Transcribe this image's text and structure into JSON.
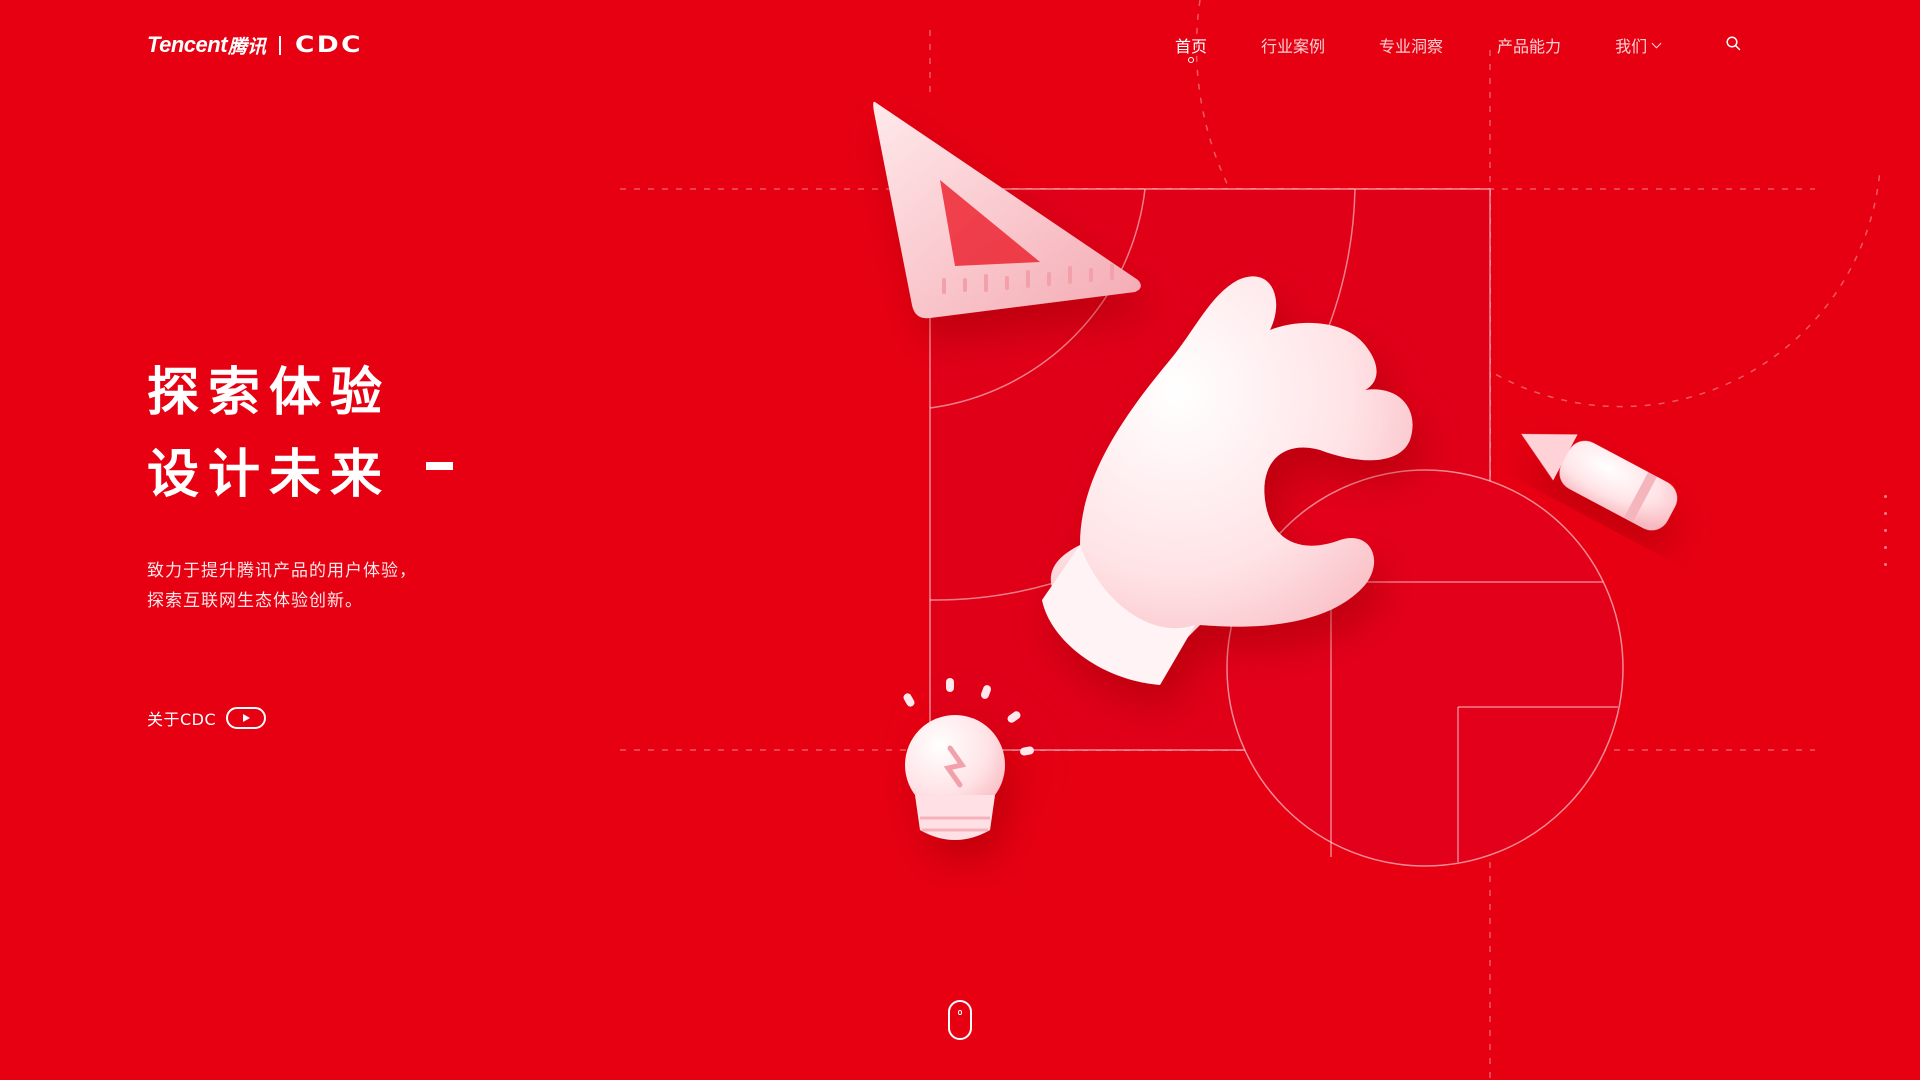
{
  "brand": {
    "tencent": "Tencent",
    "tencent_cn": "腾讯",
    "cdc": "CDC"
  },
  "nav": {
    "items": [
      {
        "label": "首页",
        "active": true
      },
      {
        "label": "行业案例",
        "active": false
      },
      {
        "label": "专业洞察",
        "active": false
      },
      {
        "label": "产品能力",
        "active": false
      },
      {
        "label": "我们",
        "active": false,
        "has_dropdown": true
      }
    ],
    "search_icon": "search-icon"
  },
  "hero": {
    "line1": "探索体验",
    "line2": "设计未来",
    "description_line1": "致力于提升腾讯产品的用户体验，",
    "description_line2": "探索互联网生态体验创新。",
    "about_label": "关于CDC"
  },
  "colors": {
    "background": "#e60012",
    "accent": "#ffffff",
    "art_pink": "#ffd6db"
  },
  "icons": {
    "play": "play-icon",
    "scroll": "mouse-scroll-icon"
  }
}
